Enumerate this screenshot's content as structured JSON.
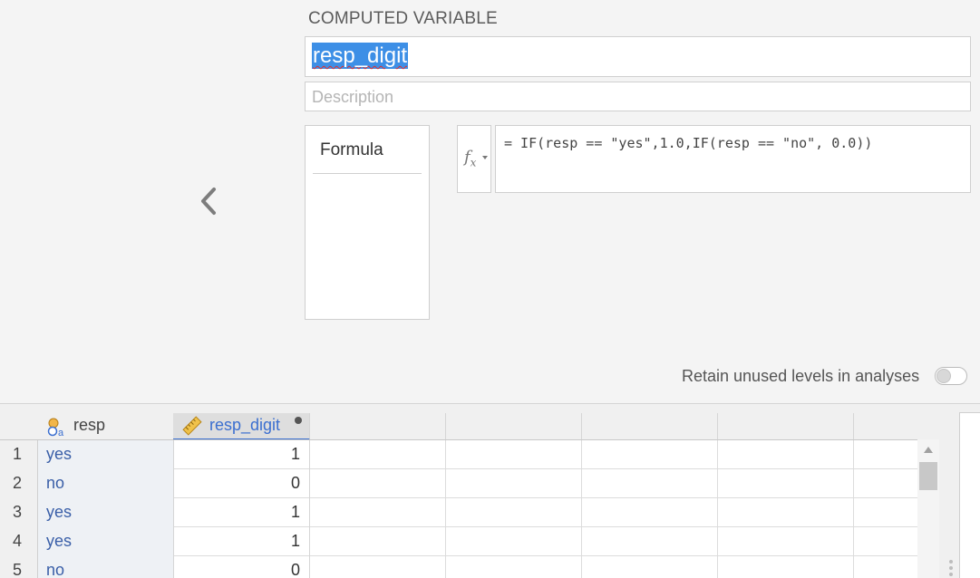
{
  "setup": {
    "section_title": "COMPUTED VARIABLE",
    "variable_name": "resp_digit",
    "description_placeholder": "Description",
    "formula_list": [
      "Formula"
    ],
    "formula_function_button": "fx",
    "formula": "= IF(resp == \"yes\",1.0,IF(resp == \"no\", 0.0))",
    "retain_unused_levels_label": "Retain unused levels in analyses",
    "retain_unused_levels": false
  },
  "grid": {
    "columns": [
      {
        "name": "resp",
        "type_icon": "nominal-icon"
      },
      {
        "name": "resp_digit",
        "type_icon": "ruler-icon",
        "selected": true
      }
    ],
    "rows": [
      {
        "num": "1",
        "resp": "yes",
        "resp_digit": "1"
      },
      {
        "num": "2",
        "resp": "no",
        "resp_digit": "0"
      },
      {
        "num": "3",
        "resp": "yes",
        "resp_digit": "1"
      },
      {
        "num": "4",
        "resp": "yes",
        "resp_digit": "1"
      },
      {
        "num": "5",
        "resp": "no",
        "resp_digit": "0"
      }
    ]
  },
  "colors": {
    "accent": "#3b6fd0",
    "selection": "#3d8fe6",
    "nominal_text": "#3a5fa8"
  }
}
